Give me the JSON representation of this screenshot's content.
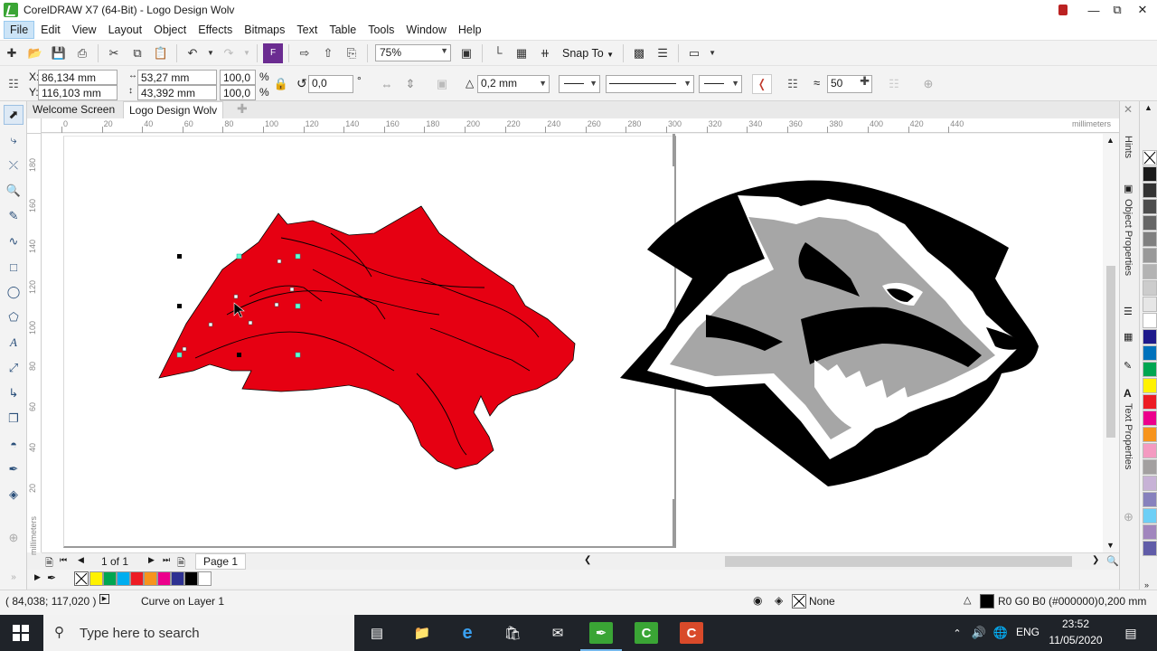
{
  "window": {
    "title": "CorelDRAW X7 (64-Bit) - Logo Design Wolv"
  },
  "menu": {
    "items": [
      "File",
      "Edit",
      "View",
      "Layout",
      "Object",
      "Effects",
      "Bitmaps",
      "Text",
      "Table",
      "Tools",
      "Window",
      "Help"
    ],
    "active": "File"
  },
  "standard_toolbar": {
    "zoom": "75%",
    "snap_to": "Snap To"
  },
  "property_bar": {
    "x_label": "X:",
    "x_value": "86,134 mm",
    "y_label": "Y:",
    "y_value": "116,103 mm",
    "width_value": "53,27 mm",
    "height_value": "43,392 mm",
    "scale_x": "100,0",
    "scale_y": "100,0",
    "percent": "%",
    "rotation": "0,0",
    "degree": "°",
    "outline_width": "0,2 mm",
    "smoothing_value": "50"
  },
  "doc_tabs": {
    "welcome": "Welcome Screen",
    "document": "Logo Design Wolv"
  },
  "rulers": {
    "units": "millimeters",
    "h_ticks": [
      "0",
      "20",
      "40",
      "60",
      "80",
      "100",
      "120",
      "140",
      "160",
      "180",
      "200",
      "220",
      "240",
      "260",
      "280",
      "300",
      "320",
      "340",
      "360",
      "380",
      "400",
      "420",
      "440"
    ],
    "v_ticks": [
      "180",
      "160",
      "140",
      "120",
      "100",
      "80",
      "60",
      "40",
      "20"
    ],
    "v_units": "millimeters"
  },
  "page_nav": {
    "page_count": "1 of 1",
    "page_tab": "Page 1"
  },
  "dockers": {
    "hints": "Hints",
    "object_properties": "Object Properties",
    "text_properties": "Text Properties"
  },
  "status": {
    "cursor_position": "( 84,038; 117,020 )",
    "object_info": "Curve on Layer 1",
    "fill": "None",
    "outline_color": "R0 G0 B0 (#000000)",
    "outline_width": "0,200 mm"
  },
  "taskbar": {
    "search_placeholder": "Type here to search",
    "language": "ENG",
    "time": "23:52",
    "date": "11/05/2020"
  },
  "colors": {
    "wolf_red": "#e60012",
    "wolf_gray": "#a6a6a6",
    "accent": "#3aa535",
    "palette": [
      "#ffffff",
      "#000000",
      "#1a1a1a",
      "#333333",
      "#4d4d4d",
      "#666666",
      "#808080",
      "#999999",
      "#b3b3b3",
      "#cccccc",
      "#e6e6e6",
      "#ffffff",
      "#1f1a8c",
      "#0072bc",
      "#00a651",
      "#fff200",
      "#ed1c24",
      "#ec008c",
      "#f7941d",
      "#f49ac1",
      "#a3a0a0",
      "#c7b2d6",
      "#8781bd",
      "#6dcff6",
      "#a186be",
      "#605ca8"
    ],
    "doc_palette": [
      "#ffffff",
      "#fff200",
      "#00a651",
      "#00aeef",
      "#ed1c24",
      "#f7941d",
      "#ec008c",
      "#2e3192",
      "#000000",
      "#ffffff"
    ]
  }
}
